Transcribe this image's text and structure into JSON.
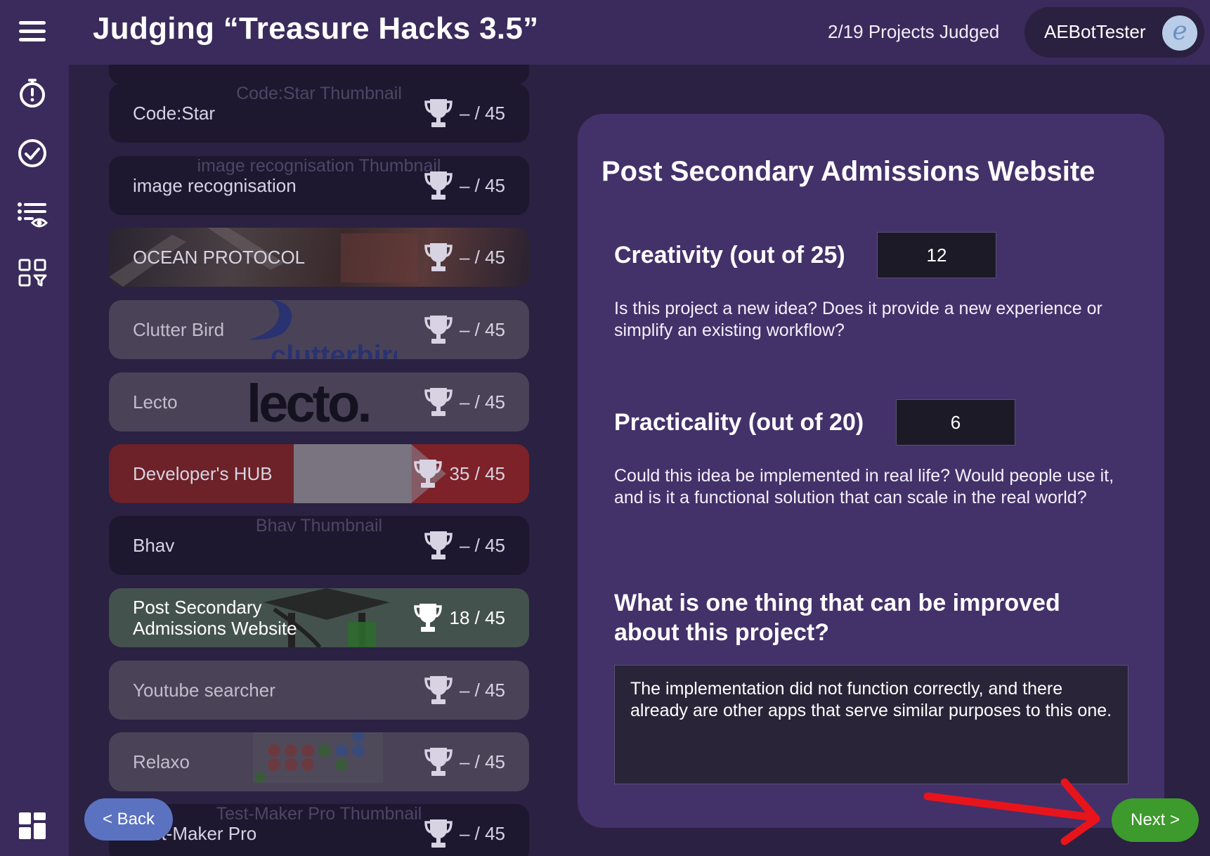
{
  "header": {
    "title": "Judging “Treasure Hacks 3.5”",
    "progress": "2/19 Projects Judged",
    "user_name": "AEBotTester",
    "avatar_letter": "e"
  },
  "sidebar": {
    "icons": [
      "menu-icon",
      "timer-icon",
      "check-circle-icon",
      "list-eye-icon",
      "grid-filter-icon",
      "dashboard-icon"
    ]
  },
  "projects": [
    {
      "name": "Code:Star",
      "thumbnail_alt": "Code:Star Thumbnail",
      "score": "– / 45"
    },
    {
      "name": "image recognisation",
      "thumbnail_alt": "image recognisation Thumbnail",
      "score": "– / 45"
    },
    {
      "name": "OCEAN PROTOCOL",
      "thumbnail_alt": "",
      "score": "– / 45"
    },
    {
      "name": "Clutter Bird",
      "thumbnail_alt": "",
      "logo_text": "clutterbird",
      "score": "– / 45"
    },
    {
      "name": "Lecto",
      "thumbnail_alt": "",
      "logo_text": "lecto.",
      "score": "– / 45"
    },
    {
      "name": "Developer's HUB",
      "thumbnail_alt": "",
      "score": "35 / 45"
    },
    {
      "name": "Bhav",
      "thumbnail_alt": "Bhav Thumbnail",
      "score": "– / 45"
    },
    {
      "name": "Post Secondary Admissions Website",
      "thumbnail_alt": "",
      "score": "18 / 45",
      "selected": true
    },
    {
      "name": "Youtube searcher",
      "thumbnail_alt": "",
      "score": "– / 45"
    },
    {
      "name": "Relaxo",
      "thumbnail_alt": "",
      "score": "– / 45"
    },
    {
      "name": "Test-Maker Pro",
      "thumbnail_alt": "Test-Maker Pro Thumbnail",
      "score": "– / 45"
    }
  ],
  "buttons": {
    "back": "< Back",
    "next": "Next >"
  },
  "panel": {
    "project_title": "Post Secondary Admissions Website",
    "criteria": [
      {
        "label": "Creativity (out of 25)",
        "value": "12",
        "description": "Is this project a new idea? Does it provide a new experience or simplify an existing workflow?"
      },
      {
        "label": "Practicality (out of 20)",
        "value": "6",
        "description": "Could this idea be implemented in real life? Would people use it, and is it a functional solution that can scale in the real world?"
      }
    ],
    "question": "What is one thing that can be improved about this project?",
    "feedback": "The implementation did not function correctly, and there already are other apps that serve similar purposes to this one."
  },
  "colors": {
    "background": "#2b2142",
    "header": "#3a2b5c",
    "panel": "#43316a",
    "next_button": "#3d9a2c",
    "back_button": "#5b72c0",
    "annotation_arrow": "#e8141c"
  }
}
